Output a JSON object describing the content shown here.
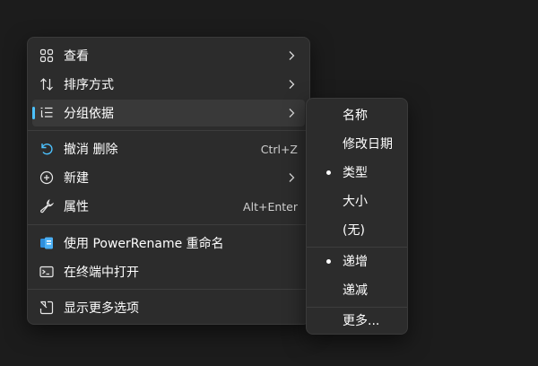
{
  "main_menu": {
    "items": [
      {
        "label": "查看",
        "icon": "grid-icon",
        "has_submenu": true
      },
      {
        "label": "排序方式",
        "icon": "sort-icon",
        "has_submenu": true
      },
      {
        "label": "分组依据",
        "icon": "group-list-icon",
        "has_submenu": true,
        "highlighted": true
      },
      {
        "label": "撤消 删除",
        "icon": "undo-icon",
        "shortcut": "Ctrl+Z"
      },
      {
        "label": "新建",
        "icon": "new-plus-icon",
        "has_submenu": true
      },
      {
        "label": "属性",
        "icon": "wrench-icon",
        "shortcut": "Alt+Enter"
      },
      {
        "label": "使用 PowerRename 重命名",
        "icon": "powerrename-icon"
      },
      {
        "label": "在终端中打开",
        "icon": "terminal-icon"
      },
      {
        "label": "显示更多选项",
        "icon": "show-more-icon"
      }
    ]
  },
  "sub_menu": {
    "items": [
      {
        "label": "名称",
        "selected": false
      },
      {
        "label": "修改日期",
        "selected": false
      },
      {
        "label": "类型",
        "selected": true
      },
      {
        "label": "大小",
        "selected": false
      },
      {
        "label": "(无)",
        "selected": false
      },
      {
        "label": "递增",
        "selected": true
      },
      {
        "label": "递减",
        "selected": false
      },
      {
        "label": "更多...",
        "selected": false
      }
    ]
  },
  "colors": {
    "background": "#1c1c1c",
    "menu_bg": "#2c2c2c",
    "highlight": "#393939",
    "accent": "#4cc2ff"
  }
}
